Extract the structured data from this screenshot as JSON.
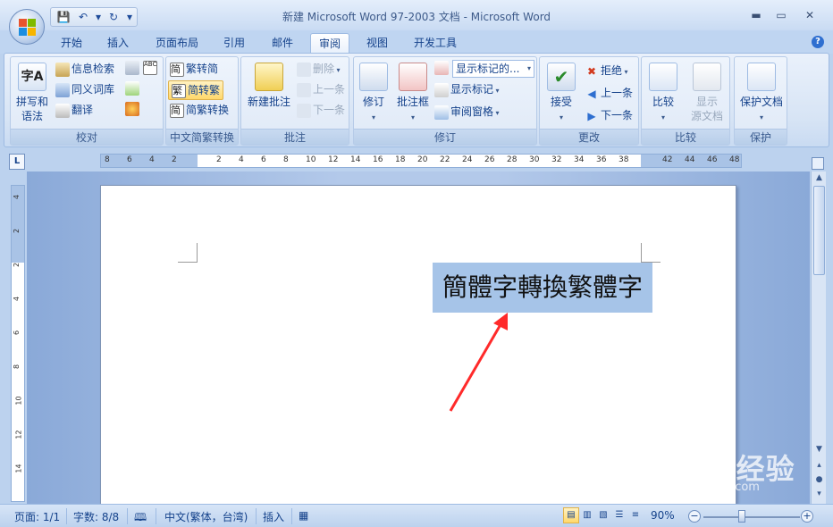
{
  "window": {
    "title": "新建 Microsoft Word 97-2003 文档 - Microsoft Word",
    "minimize": "▬",
    "maximize": "▭",
    "close": "✕"
  },
  "qat": {
    "save": "💾",
    "undo": "↶",
    "dropdown1": "▾",
    "redo": "↻",
    "customize": "▾"
  },
  "tabs": [
    {
      "label": "开始"
    },
    {
      "label": "插入"
    },
    {
      "label": "页面布局"
    },
    {
      "label": "引用"
    },
    {
      "label": "邮件"
    },
    {
      "label": "审阅"
    },
    {
      "label": "视图"
    },
    {
      "label": "开发工具"
    }
  ],
  "active_tab": "审阅",
  "ribbon": {
    "proofing": {
      "label": "校对",
      "spelling_label": "拼写和\n语法",
      "research": "信息检索",
      "thesaurus": "同义词库",
      "translate": "翻译"
    },
    "chinese": {
      "label": "中文简繁转换",
      "to_simplified": "繁转简",
      "to_traditional": "简转繁",
      "convert": "简繁转换"
    },
    "comments": {
      "label": "批注",
      "new_comment": "新建批注",
      "delete": "删除",
      "previous": "上一条",
      "next": "下一条"
    },
    "tracking": {
      "label": "修订",
      "track_changes": "修订",
      "balloons": "批注框",
      "display_combo": "显示标记的...",
      "show_markup": "显示标记",
      "reviewing_pane": "审阅窗格"
    },
    "changes": {
      "label": "更改",
      "accept": "接受",
      "reject": "拒绝",
      "previous": "上一条",
      "next": "下一条"
    },
    "compare": {
      "label": "比较",
      "compare": "比较",
      "show_source": "显示\n源文档"
    },
    "protect": {
      "label": "保护",
      "protect_doc": "保护文档"
    }
  },
  "ruler": {
    "tab_selector": "L",
    "h_numbers_left": [
      "8",
      "6",
      "4",
      "2"
    ],
    "h_numbers_right": [
      "2",
      "4",
      "6",
      "8",
      "10",
      "12",
      "14",
      "16",
      "18",
      "20",
      "22",
      "24",
      "26",
      "28",
      "30",
      "32",
      "34",
      "36",
      "38"
    ],
    "h_numbers_margin_right": [
      "42",
      "44",
      "46",
      "48"
    ],
    "v_numbers": [
      "4",
      "2",
      "2",
      "4",
      "6",
      "8",
      "10",
      "12",
      "14"
    ]
  },
  "document": {
    "selected_text": "簡體字轉換繁體字"
  },
  "statusbar": {
    "page": "页面: 1/1",
    "words": "字数: 8/8",
    "language": "中文(繁体，台湾)",
    "mode": "插入",
    "zoom": "90%",
    "zoom_minus": "−",
    "zoom_plus": "+"
  },
  "watermark": {
    "main": "Baidu经验",
    "sub": "jingyan.baidu.com"
  },
  "colors": {
    "ribbon_bg": "#dfe9f7",
    "accent_text": "#15428b",
    "selection": "#a6c4e8",
    "highlight_button": "#ffd86b",
    "annotation_arrow": "#ff2a2a"
  }
}
